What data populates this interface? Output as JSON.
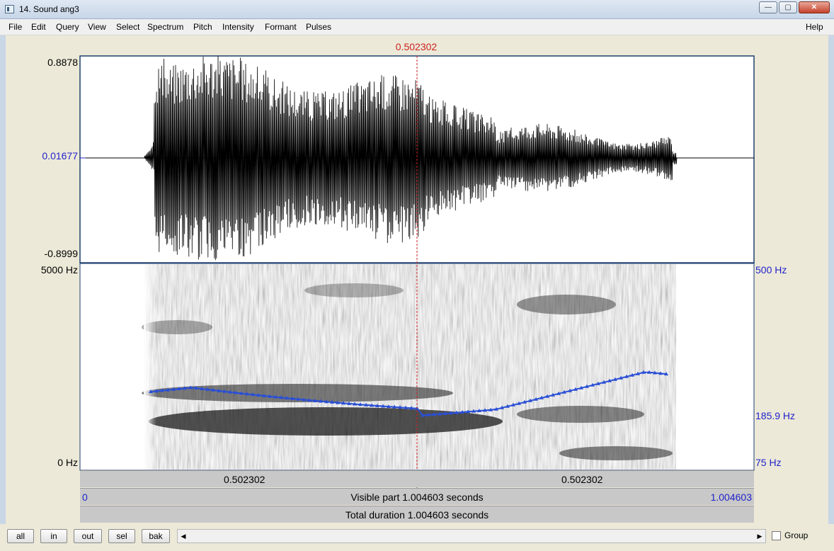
{
  "window": {
    "title": "14. Sound ang3",
    "controls": {
      "minimize": "—",
      "maximize": "▢",
      "close": "✕"
    }
  },
  "menu": [
    "File",
    "Edit",
    "Query",
    "View",
    "Select",
    "Spectrum",
    "Pitch",
    "Intensity",
    "Formant",
    "Pulses"
  ],
  "help": "Help",
  "cursor_time": "0.502302",
  "waveform": {
    "ymax": "0.8878",
    "ymid": "0.01677",
    "ymin": "-0.8999"
  },
  "spectrogram": {
    "freq_top": "5000 Hz",
    "freq_bottom": "0 Hz",
    "pitch_top": "500 Hz",
    "pitch_cursor": "185.9 Hz",
    "pitch_bottom": "75 Hz"
  },
  "time_rows": {
    "left_segment": "0.502302",
    "right_segment": "0.502302",
    "visible_start": "0",
    "visible_part": "Visible part 1.004603 seconds",
    "visible_end": "1.004603",
    "total_duration": "Total duration 1.004603 seconds"
  },
  "buttons": [
    "all",
    "in",
    "out",
    "sel",
    "bak"
  ],
  "scroll": {
    "left_arrow": "◀",
    "right_arrow": "▶"
  },
  "group_label": "Group",
  "colors": {
    "cursor": "#cc2222",
    "pitch": "#2a4fd6",
    "axis_label_blue": "#2222cc"
  }
}
